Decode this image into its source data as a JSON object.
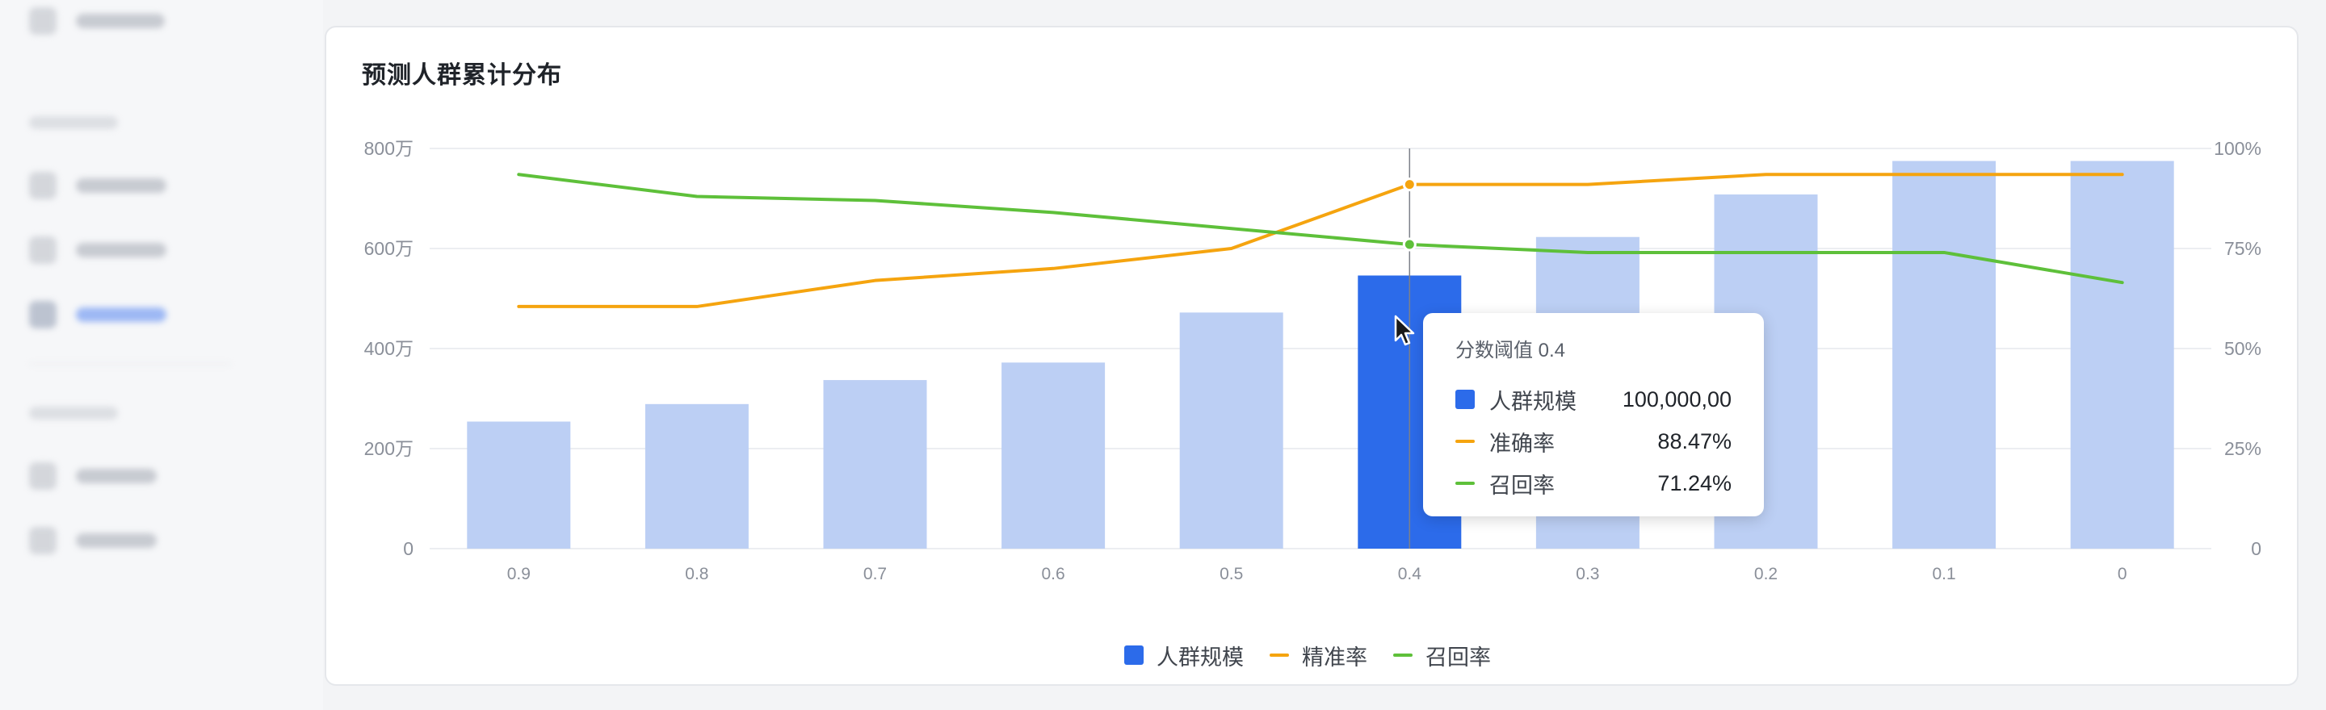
{
  "card": {
    "title": "预测人群累计分布"
  },
  "colors": {
    "bar": "#bccff4",
    "bar_active": "#2c6bea",
    "precision": "#f5a40f",
    "recall": "#5ec03a",
    "grid": "#eceef1"
  },
  "chart_data": {
    "type": "bar",
    "title": "预测人群累计分布",
    "categories": [
      "0.9",
      "0.8",
      "0.7",
      "0.6",
      "0.5",
      "0.4",
      "0.3",
      "0.2",
      "0.1",
      "0"
    ],
    "y_left": {
      "ticks": [
        "0",
        "200万",
        "400万",
        "600万",
        "800万"
      ],
      "min": 0,
      "max": 800,
      "unit": "万"
    },
    "y_right": {
      "ticks": [
        "0",
        "25%",
        "50%",
        "75%",
        "100%"
      ],
      "min": 0,
      "max": 100,
      "unit": "%"
    },
    "series": [
      {
        "name": "人群规模",
        "type": "bar",
        "axis": "left",
        "values": [
          254,
          289,
          337,
          372,
          472,
          546,
          623,
          708,
          775,
          775
        ]
      },
      {
        "name": "精准率",
        "type": "line",
        "axis": "right",
        "values": [
          60.5,
          60.5,
          67,
          70,
          75,
          91,
          91,
          93.5,
          93.5,
          93.5
        ]
      },
      {
        "name": "召回率",
        "type": "line",
        "axis": "right",
        "values": [
          93.5,
          88,
          87,
          84,
          80,
          76,
          74,
          74,
          74,
          66.5
        ]
      }
    ],
    "highlight_index": 5,
    "grid": true,
    "legend_position": "bottom-center"
  },
  "tooltip": {
    "title": "分数阈值 0.4",
    "rows": [
      {
        "label": "人群规模",
        "value": "100,000,00"
      },
      {
        "label": "准确率",
        "value": "88.47%"
      },
      {
        "label": "召回率",
        "value": "71.24%"
      }
    ]
  },
  "legend": {
    "items": [
      "人群规模",
      "精准率",
      "召回率"
    ]
  }
}
